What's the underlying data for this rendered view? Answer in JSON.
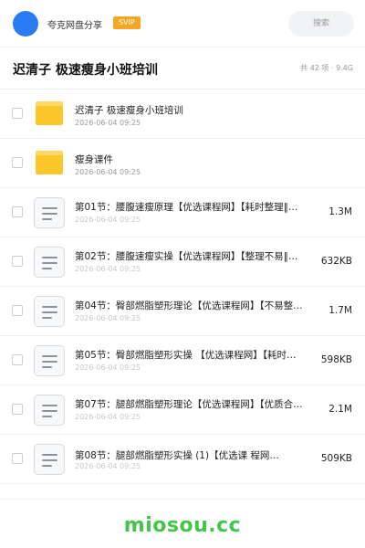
{
  "header": {
    "username": "夸克网盘分享",
    "badge": "SVIP",
    "search_label": "搜索"
  },
  "folder": {
    "title": "迟清子 极速瘦身小班培训",
    "meta": "共 42 项 · 9.4G"
  },
  "items": [
    {
      "type": "folder",
      "name": "迟清子 极速瘦身小班培训",
      "date": "2026-06-04 09:25",
      "size": ""
    },
    {
      "type": "folder",
      "name": "瘦身课件",
      "date": "2026-06-04 09:25",
      "size": ""
    },
    {
      "type": "file",
      "name": "第01节：腰腹速瘦原理【优选课程网】【耗时整理‖…",
      "date": "2026-06-04 09:25",
      "size": "1.3M"
    },
    {
      "type": "file",
      "name": "第02节：腰腹速瘦实操【优选课程网】【整理不易‖…",
      "date": "2026-06-04 09:25",
      "size": "632KB"
    },
    {
      "type": "file",
      "name": "第04节：臀部燃脂塑形理论【优选课程网】【不易整…",
      "date": "2026-06-04 09:25",
      "size": "1.7M"
    },
    {
      "type": "file",
      "name": "第05节：臀部燃脂塑形实操 【优选课程网】【耗时…",
      "date": "2026-06-04 09:25",
      "size": "598KB"
    },
    {
      "type": "file",
      "name": "第07节：腿部燃脂塑形理论【优选课程网】【优质合…",
      "date": "2026-06-04 09:25",
      "size": "2.1M"
    },
    {
      "type": "file",
      "name": "第08节：腿部燃脂塑形实操 (1)【优选课 程网…",
      "date": "2026-06-04 09:25",
      "size": "509KB"
    }
  ],
  "watermark": "miosou.cc",
  "colors": {
    "accent": "#2b7bf5",
    "svip": "#f5a623",
    "folder": "#fbc72a",
    "watermark": "#44c449"
  }
}
